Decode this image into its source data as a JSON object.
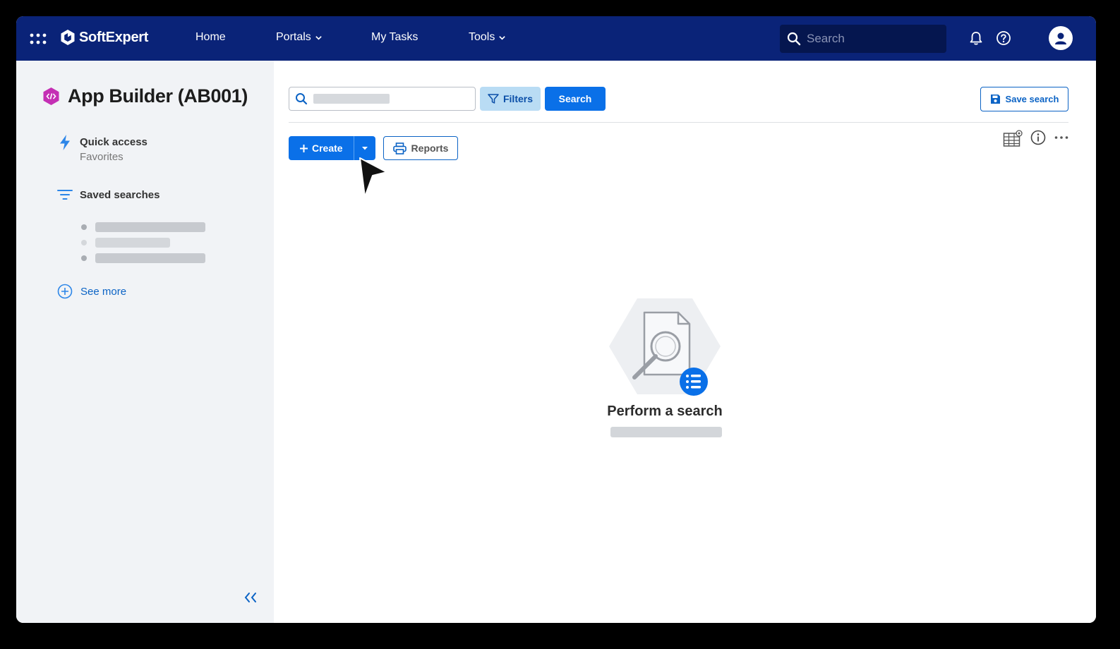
{
  "topbar": {
    "brand": "SoftExpert",
    "nav": [
      {
        "label": "Home"
      },
      {
        "label": "Portals"
      },
      {
        "label": "My Tasks"
      },
      {
        "label": "Tools"
      }
    ],
    "search_placeholder": "Search",
    "icons": [
      "apps-grid-icon",
      "bell-icon",
      "help-icon",
      "user-avatar-icon"
    ]
  },
  "sidebar": {
    "app_title": "App Builder (AB001)",
    "quick_access": {
      "title": "Quick access",
      "subtitle": "Favorites"
    },
    "saved_searches": {
      "title": "Saved searches"
    },
    "see_more": "See more"
  },
  "main": {
    "toolbar": {
      "filters_label": "Filters",
      "search_label": "Search",
      "save_search_label": "Save search",
      "create_label": "Create",
      "reports_label": "Reports"
    },
    "empty_state": {
      "title": "Perform a search"
    }
  },
  "colors": {
    "topbar": "#0a2378",
    "primary": "#0a70e8",
    "filters_bg": "#b9dcf4",
    "sidebar_bg": "#f1f3f6",
    "app_icon": "#c42fb4"
  }
}
